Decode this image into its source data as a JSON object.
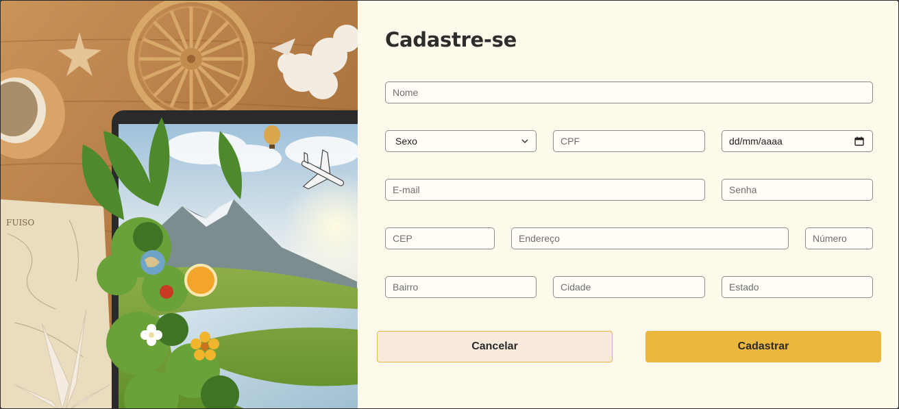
{
  "form": {
    "title": "Cadastre-se",
    "fields": {
      "nome": "Nome",
      "sexo": "Sexo",
      "cpf": "CPF",
      "data_nascimento": "dd/mm/aaaa",
      "email": "E-mail",
      "senha": "Senha",
      "cep": "CEP",
      "endereco": "Endereço",
      "numero": "Número",
      "bairro": "Bairro",
      "cidade": "Cidade",
      "estado": "Estado"
    },
    "buttons": {
      "cancel": "Cancelar",
      "submit": "Cadastrar"
    }
  },
  "colors": {
    "panel_bg": "#fefaeb",
    "accent": "#ebb73e",
    "cancel_bg": "#f9eadb",
    "text": "#2d2d2d"
  },
  "icons": {
    "select_arrow": "chevron-down-icon",
    "date_picker": "calendar-icon"
  }
}
